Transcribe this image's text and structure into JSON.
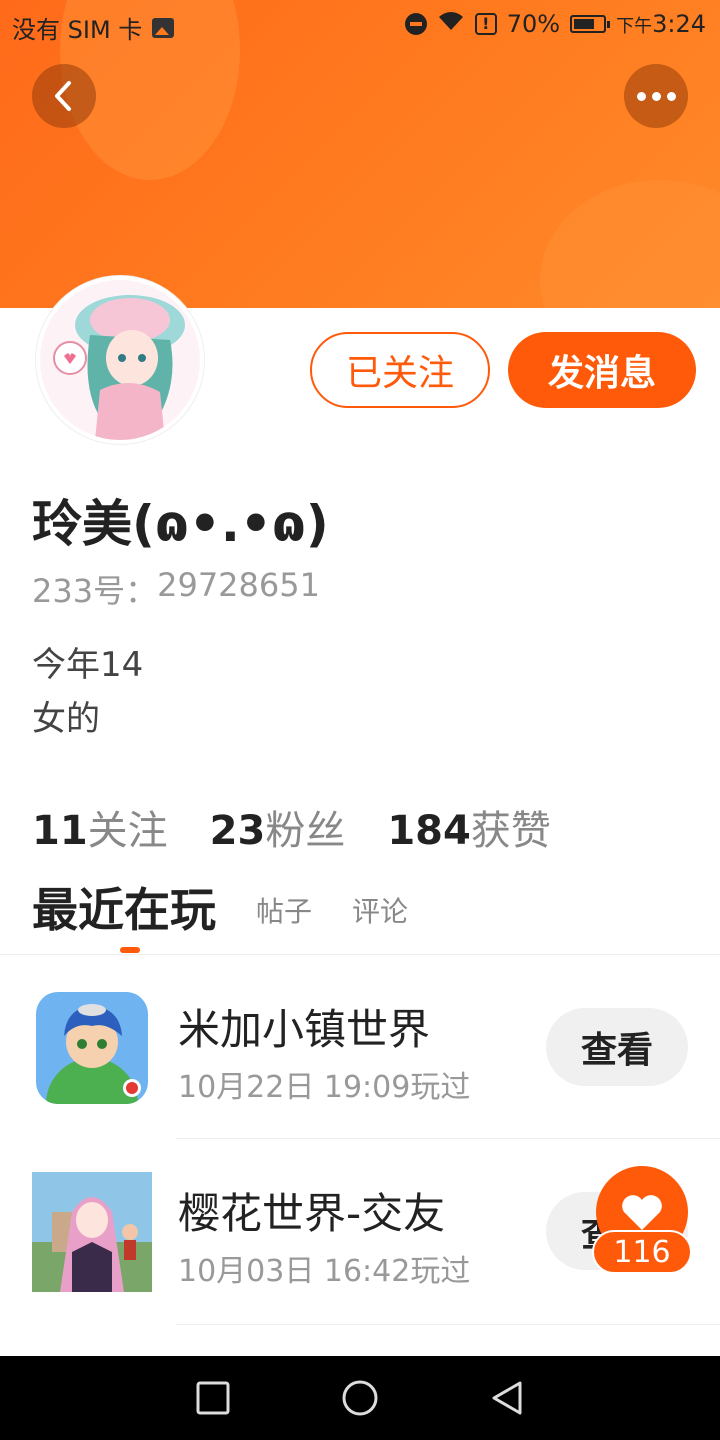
{
  "status_bar": {
    "carrier": "没有 SIM 卡",
    "battery": "70%",
    "time_prefix": "下午",
    "time": "3:24",
    "battery_level": 0.7
  },
  "header": {
    "back_icon": "chevron-left-icon",
    "more_icon": "more-dots-icon"
  },
  "profile": {
    "avatar_icon": "avatar-anime-girl",
    "followed_label": "已关注",
    "message_label": "发消息",
    "name": "玲美(ɷ•.•ɷ)",
    "id_label": "233号：",
    "id_value": "29728651",
    "bio_line1": "今年14",
    "bio_line2": "女的"
  },
  "stats": {
    "following_num": "11",
    "following_label": "关注",
    "fans_num": "23",
    "fans_label": "粉丝",
    "likes_num": "184",
    "likes_label": "获赞"
  },
  "tabs": {
    "active": "最近在玩",
    "posts": "帖子",
    "comments": "评论"
  },
  "games": [
    {
      "title": "米加小镇世界",
      "time": "10月22日 19:09玩过",
      "button": "查看"
    },
    {
      "title": "樱花世界-交友",
      "time": "10月03日 16:42玩过",
      "button": "查看"
    }
  ],
  "floating": {
    "like_icon": "heart-icon",
    "like_count": "116"
  },
  "colors": {
    "accent": "#ff5a0a",
    "banner": "#ff7a1f"
  }
}
